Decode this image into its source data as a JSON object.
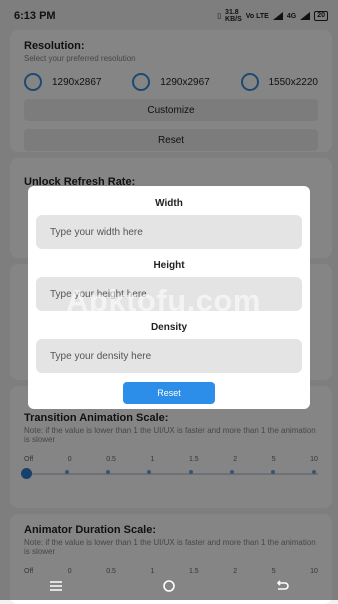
{
  "status_bar": {
    "time": "6:13 PM",
    "battery": "20",
    "speed": "31.8",
    "speed_unit": "KB/S",
    "volte": "Vo LTE",
    "network": "4G"
  },
  "resolution_card": {
    "title": "Resolution:",
    "subtitle": "Select your preferred resolution",
    "options": [
      "1290x2867",
      "1290x2967",
      "1550x2220"
    ],
    "customize_label": "Customize",
    "reset_label": "Reset"
  },
  "refresh_card": {
    "title": "Unlock Refresh Rate:"
  },
  "transition_card": {
    "title": "Transition Animation Scale:",
    "subtitle": "Note: if the value is lower than 1 the UI/UX is faster and more than 1 the animation is slower",
    "ticks": [
      "Off",
      "0",
      "0.5",
      "1",
      "1.5",
      "2",
      "5",
      "10"
    ]
  },
  "animator_card": {
    "title": "Animator Duration Scale:",
    "subtitle": "Note: if the value is lower than 1 the UI/UX is faster and more than 1 the animation is slower",
    "ticks": [
      "Off",
      "0",
      "0.5",
      "1",
      "1.5",
      "2",
      "5",
      "10"
    ]
  },
  "dialog": {
    "width_label": "Width",
    "width_placeholder": "Type your width here",
    "height_label": "Height",
    "height_placeholder": "Type your height here",
    "density_label": "Density",
    "density_placeholder": "Type your density here",
    "reset_label": "Reset"
  },
  "watermark": "Apktofu.com",
  "colors": {
    "accent": "#2c8ee8",
    "scrim": "#000000"
  }
}
